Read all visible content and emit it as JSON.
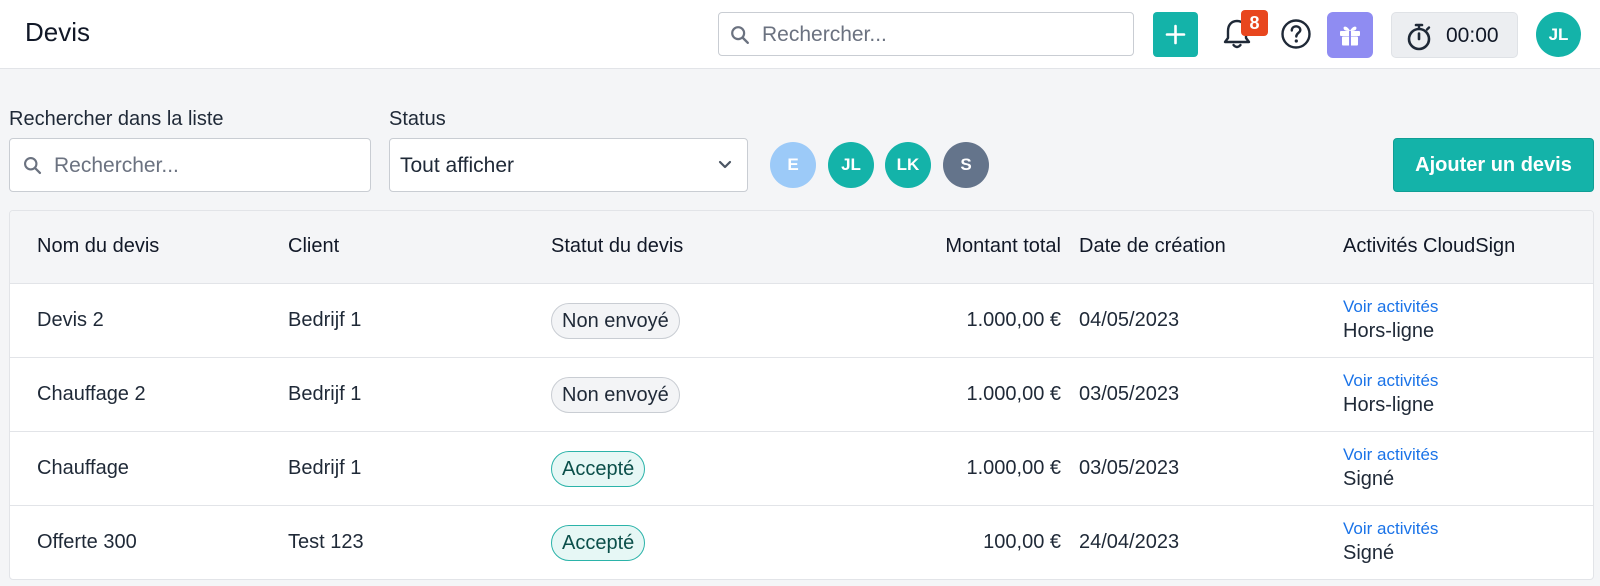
{
  "header": {
    "title": "Devis",
    "search_placeholder": "Rechercher...",
    "notifications_count": "8",
    "timer": "00:00",
    "user_initials": "JL"
  },
  "filters": {
    "search_label": "Rechercher dans la liste",
    "search_placeholder": "Rechercher...",
    "status_label": "Status",
    "status_value": "Tout afficher",
    "assignees": [
      {
        "initials": "E",
        "color": "#9ccaf8"
      },
      {
        "initials": "JL",
        "color": "#14b3a9"
      },
      {
        "initials": "LK",
        "color": "#14b3a9"
      },
      {
        "initials": "S",
        "color": "#64748b"
      }
    ],
    "add_button": "Ajouter un devis"
  },
  "table": {
    "columns": [
      "Nom du devis",
      "Client",
      "Statut du devis",
      "Montant total",
      "Date de création",
      "Activités CloudSign"
    ],
    "rows": [
      {
        "name": "Devis 2",
        "client": "Bedrijf 1",
        "status": "Non envoyé",
        "status_type": "neutral",
        "amount": "1.000,00 €",
        "date": "04/05/2023",
        "activity_link": "Voir activités",
        "activity_status": "Hors-ligne"
      },
      {
        "name": "Chauffage 2",
        "client": "Bedrijf 1",
        "status": "Non envoyé",
        "status_type": "neutral",
        "amount": "1.000,00 €",
        "date": "03/05/2023",
        "activity_link": "Voir activités",
        "activity_status": "Hors-ligne"
      },
      {
        "name": "Chauffage",
        "client": "Bedrijf 1",
        "status": "Accepté",
        "status_type": "ok",
        "amount": "1.000,00 €",
        "date": "03/05/2023",
        "activity_link": "Voir activités",
        "activity_status": "Signé"
      },
      {
        "name": "Offerte 300",
        "client": "Test 123",
        "status": "Accepté",
        "status_type": "ok",
        "amount": "100,00 €",
        "date": "24/04/2023",
        "activity_link": "Voir activités",
        "activity_status": "Signé"
      }
    ]
  },
  "colors": {
    "accent": "#14b3a9",
    "badge": "#e8461e",
    "gift": "#8f8cf2",
    "link": "#1a73e8"
  },
  "icons": [
    "search-icon",
    "plus-icon",
    "bell-icon",
    "help-icon",
    "gift-icon",
    "stopwatch-icon",
    "chevron-down-icon"
  ]
}
